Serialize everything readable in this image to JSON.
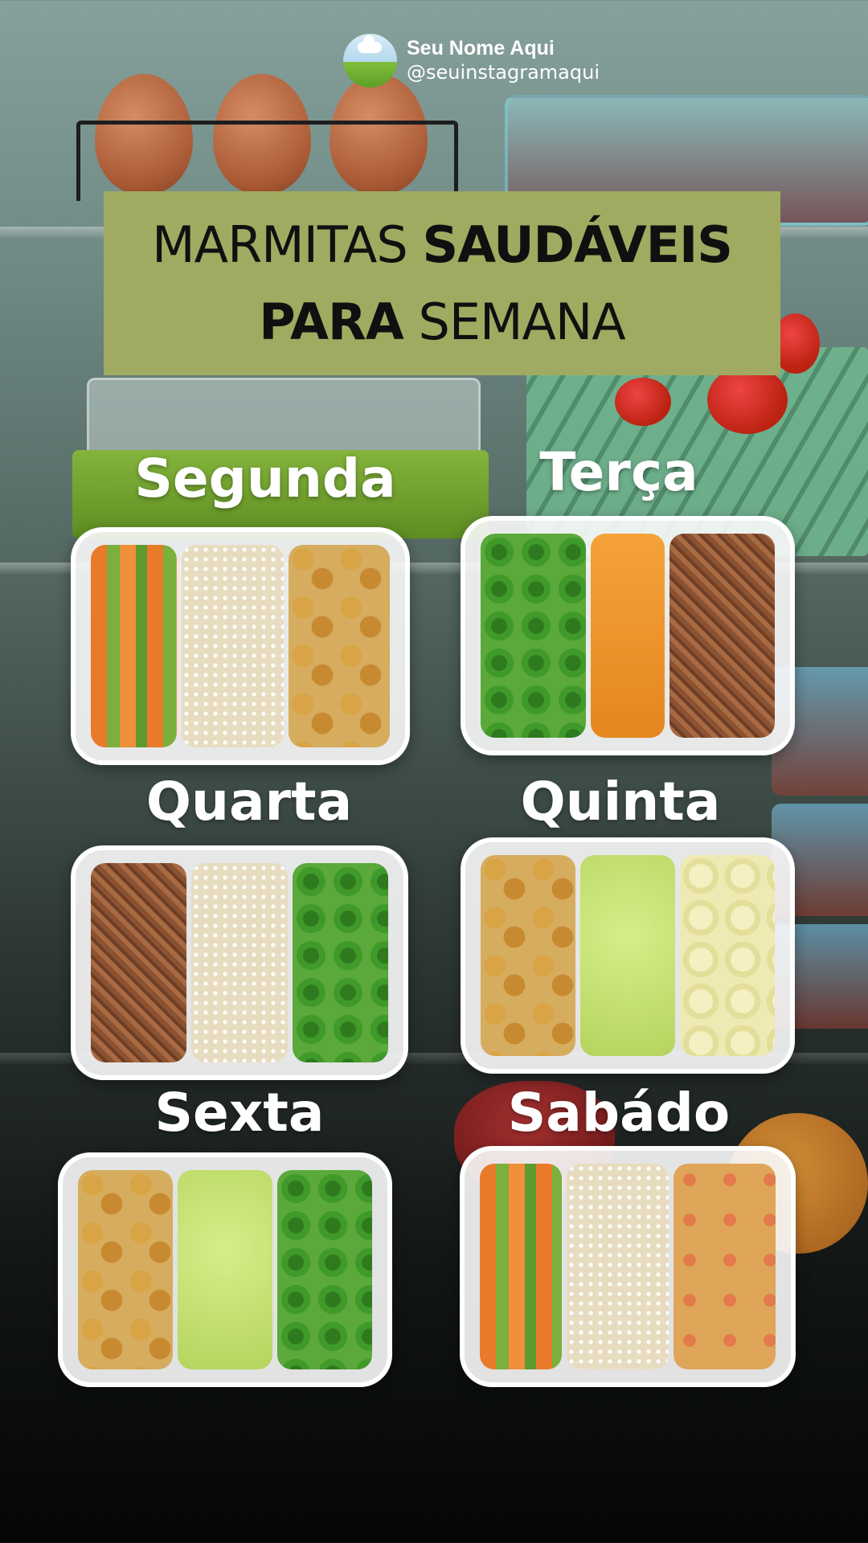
{
  "profile": {
    "name": "Seu Nome Aqui",
    "handle": "@seuinstagramaqui",
    "avatar_icon": "landscape-avatar-icon"
  },
  "title": {
    "line1_light": "MARMITAS",
    "line1_bold": "SAUDÁVEIS",
    "line2_bold": "PARA",
    "line2_light": "SEMANA",
    "box_color": "#a0ab61"
  },
  "days": [
    {
      "label": "Segunda",
      "foods": [
        "carrots-green-beans",
        "rice",
        "chicken"
      ]
    },
    {
      "label": "Terça",
      "foods": [
        "broccoli",
        "pumpkin-puree",
        "pulled-meat"
      ]
    },
    {
      "label": "Quarta",
      "foods": [
        "pulled-meat",
        "rice",
        "broccoli"
      ]
    },
    {
      "label": "Quinta",
      "foods": [
        "chicken",
        "green-puree",
        "cauliflower"
      ]
    },
    {
      "label": "Sexta",
      "foods": [
        "chicken",
        "green-puree",
        "broccoli"
      ]
    },
    {
      "label": "Sabádo",
      "foods": [
        "carrots-green-beans",
        "rice",
        "chicken-tomato"
      ]
    }
  ]
}
